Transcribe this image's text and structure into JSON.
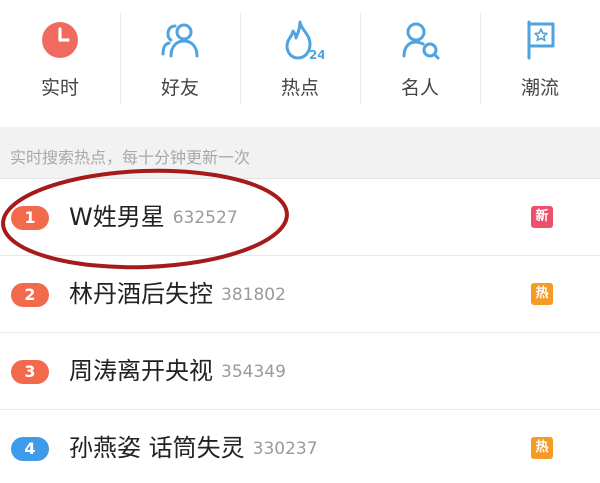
{
  "nav": {
    "items": [
      {
        "label": "实时",
        "icon": "clock-icon"
      },
      {
        "label": "好友",
        "icon": "friends-icon"
      },
      {
        "label": "热点",
        "icon": "flame-24-icon",
        "icon_text": "24"
      },
      {
        "label": "名人",
        "icon": "celebrity-icon"
      },
      {
        "label": "潮流",
        "icon": "flag-star-icon"
      }
    ]
  },
  "banner": {
    "text": "实时搜索热点，每十分钟更新一次"
  },
  "list": [
    {
      "rank": "1",
      "title": "W姓男星",
      "count": "632527",
      "badge": "新",
      "rank_color": "#f26a4b",
      "badge_color": "#ef4f6b"
    },
    {
      "rank": "2",
      "title": "林丹酒后失控",
      "count": "381802",
      "badge": "热",
      "rank_color": "#f26a4b",
      "badge_color": "#f59a24"
    },
    {
      "rank": "3",
      "title": "周涛离开央视",
      "count": "354349",
      "badge": "",
      "rank_color": "#f26a4b",
      "badge_color": ""
    },
    {
      "rank": "4",
      "title": "孙燕姿 话筒失灵",
      "count": "330237",
      "badge": "热",
      "rank_color": "#3d9be9",
      "badge_color": "#f59a24"
    }
  ],
  "colors": {
    "clock_icon": "#f06a5f",
    "nav_icon_blue": "#4ea3e0",
    "highlight_ellipse": "#a51a1a"
  }
}
